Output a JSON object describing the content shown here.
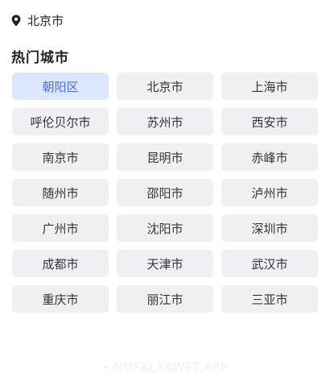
{
  "location": {
    "icon": "location-pin-icon",
    "current_city": "北京市"
  },
  "hot_cities": {
    "title": "热门城市",
    "selected": "朝阳区",
    "items": [
      "朝阳区",
      "北京市",
      "上海市",
      "呼伦贝尔市",
      "苏州市",
      "西安市",
      "南京市",
      "昆明市",
      "赤峰市",
      "随州市",
      "邵阳市",
      "泸州市",
      "广州市",
      "沈阳市",
      "深圳市",
      "成都市",
      "天津市",
      "武汉市",
      "重庆市",
      "丽江市",
      "三亚市"
    ]
  },
  "watermark": {
    "text": "• NOFKLXAWET.APP"
  },
  "colors": {
    "selected_bg": "#dde6ff",
    "selected_text": "#4a6ff0",
    "button_bg": "#f0f0f3"
  }
}
